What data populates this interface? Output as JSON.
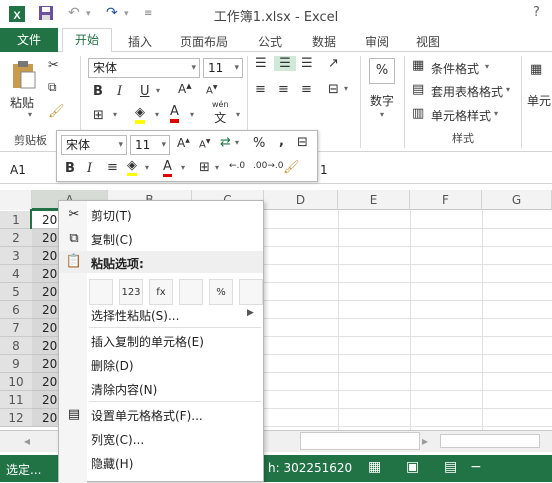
{
  "titlebar": {
    "title": "工作簿1.xlsx - Excel",
    "help": "?"
  },
  "tabs": {
    "file": "文件",
    "home": "开始",
    "insert": "插入",
    "layout": "页面布局",
    "formulas": "公式",
    "data": "数据",
    "review": "审阅",
    "view": "视图"
  },
  "ribbon": {
    "paste": "粘贴",
    "clipboard_label": "剪贴板",
    "font_name": "宋体",
    "font_size": "11",
    "number": "数字",
    "cond_format": "条件格式",
    "table_format": "套用表格格式",
    "cell_style": "单元格样式",
    "styles_label": "样式",
    "cells": "单元",
    "wen": "wén",
    "wen_char": "文"
  },
  "mini_toolbar": {
    "font_name": "宋体",
    "font_size": "11",
    "percent": "%",
    "comma": ",",
    "dec_inc": "←.0",
    "dec_dec": ".00→.0"
  },
  "formula_bar": {
    "namebox": "A1",
    "value": "1"
  },
  "columns": [
    "A",
    "B",
    "C",
    "D",
    "E",
    "F",
    "G"
  ],
  "rows": [
    "1",
    "2",
    "3",
    "4",
    "5",
    "6",
    "7",
    "8",
    "9",
    "10",
    "11",
    "12"
  ],
  "cells_a": [
    "20",
    "20",
    "20",
    "20",
    "20",
    "20",
    "20",
    "20",
    "20",
    "20",
    "20",
    "20"
  ],
  "context_menu": {
    "cut": "剪切(T)",
    "copy": "复制(C)",
    "paste_options": "粘贴选项:",
    "paste_special": "选择性粘贴(S)...",
    "insert_copied": "插入复制的单元格(E)",
    "delete": "删除(D)",
    "clear": "清除内容(N)",
    "format_cells": "设置单元格格式(F)...",
    "col_width": "列宽(C)...",
    "hide": "隐藏(H)"
  },
  "paste_icons": [
    "paste",
    "values-123",
    "formulas-fx",
    "transpose",
    "formatting-%",
    "link"
  ],
  "paste_icon_text": [
    "",
    "123",
    "fx",
    "",
    "%",
    ""
  ],
  "status": {
    "mode": "选定...",
    "count": "h: 302251620"
  },
  "colors": {
    "accent": "#217346",
    "selected_col": "#d6dbd6"
  }
}
